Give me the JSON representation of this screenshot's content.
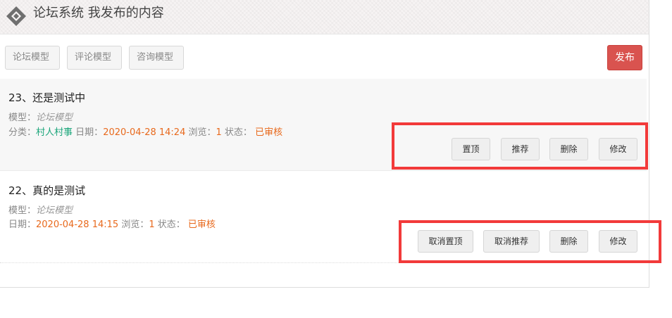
{
  "header": {
    "title": "论坛系统 我发布的内容",
    "logo_icon": "diamond-logo-icon"
  },
  "tabs": [
    {
      "label": "论坛模型"
    },
    {
      "label": "评论模型"
    },
    {
      "label": "咨询模型"
    }
  ],
  "publish_label": "发布",
  "posts": [
    {
      "title": "23、还是测试中",
      "model_label": "模型：",
      "model": "论坛模型",
      "category_label": "分类：",
      "category": "村人村事",
      "date_label": "日期：",
      "date": "2020-04-28 14:24",
      "views_label": "浏览：",
      "views": "1",
      "status_label": "状态：",
      "status": "已审核",
      "actions": [
        "置顶",
        "推荐",
        "删除",
        "修改"
      ]
    },
    {
      "title": "22、真的是测试",
      "model_label": "模型：",
      "model": "论坛模型",
      "date_label": "日期：",
      "date": "2020-04-28 14:15",
      "views_label": "浏览：",
      "views": "1",
      "status_label": "状态：",
      "status": "已审核",
      "actions": [
        "取消置顶",
        "取消推荐",
        "删除",
        "修改"
      ]
    }
  ],
  "colors": {
    "publish": "#d9534f",
    "highlight": "#f23a3a",
    "accent_green": "#1aa57a",
    "accent_orange": "#e8691c"
  }
}
